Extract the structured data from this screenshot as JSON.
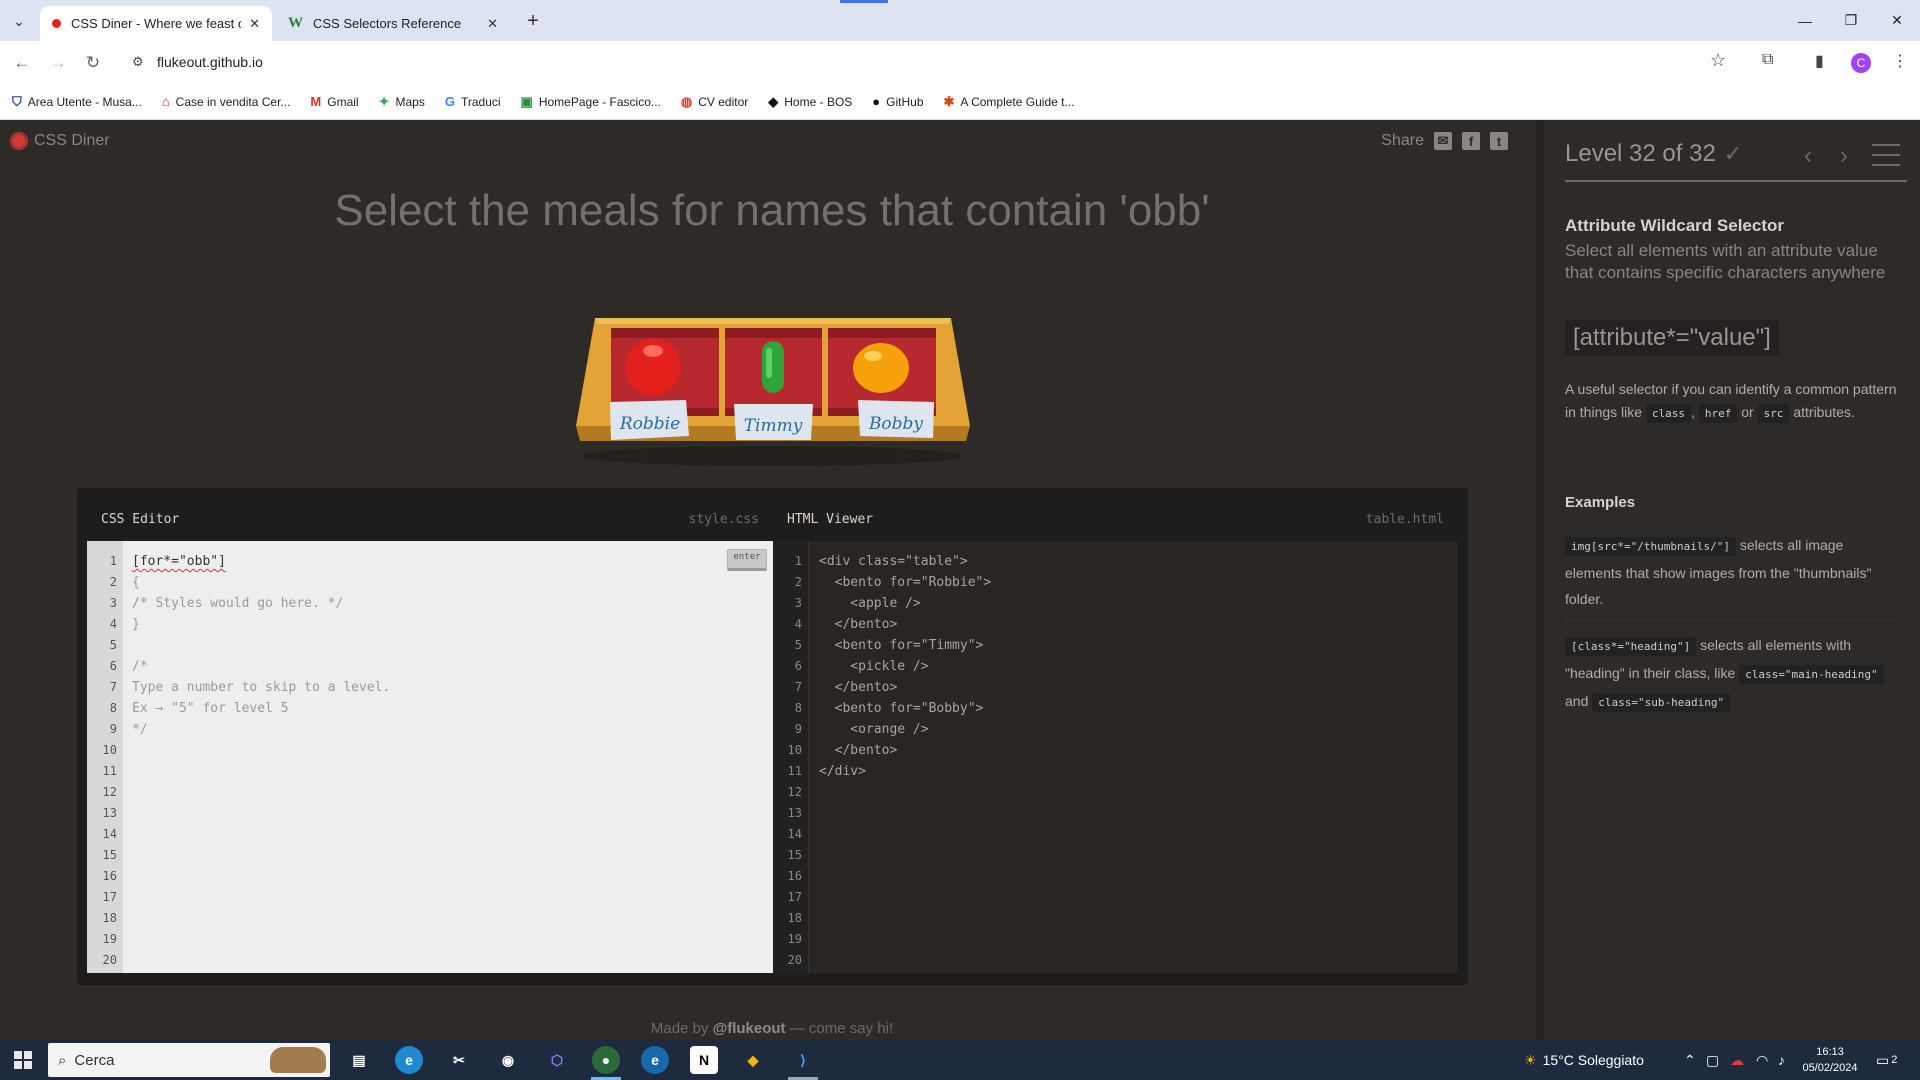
{
  "browser": {
    "tabs": [
      {
        "title": "CSS Diner - Where we feast on",
        "active": true
      },
      {
        "title": "CSS Selectors Reference",
        "active": false
      }
    ],
    "url": "flukeout.github.io",
    "avatar_letter": "C",
    "bookmarks": [
      {
        "label": "Area Utente - Musa...",
        "icon": "shield-icon"
      },
      {
        "label": "Case in vendita Cer...",
        "icon": "house-icon"
      },
      {
        "label": "Gmail",
        "icon": "gmail-icon"
      },
      {
        "label": "Maps",
        "icon": "maps-icon"
      },
      {
        "label": "Traduci",
        "icon": "translate-icon"
      },
      {
        "label": "HomePage - Fascico...",
        "icon": "page-icon"
      },
      {
        "label": "CV editor",
        "icon": "cv-icon"
      },
      {
        "label": "Home - BOS",
        "icon": "bos-icon"
      },
      {
        "label": "GitHub",
        "icon": "github-icon"
      },
      {
        "label": "A Complete Guide t...",
        "icon": "asterisk-icon"
      }
    ]
  },
  "app": {
    "brand": "CSS Diner",
    "share_label": "Share",
    "instruction": "Select the meals for names that contain 'obb'",
    "plates": [
      {
        "name": "Robbie",
        "item": "apple",
        "color": "#e3201b"
      },
      {
        "name": "Timmy",
        "item": "pickle",
        "color": "#2ea43a"
      },
      {
        "name": "Bobby",
        "item": "orange",
        "color": "#f6a10a"
      }
    ],
    "css_editor": {
      "title": "CSS Editor",
      "file": "style.css",
      "enter_label": "enter",
      "input": "[for*=\"obb\"]",
      "lines": [
        "{",
        "/* Styles would go here. */",
        "}",
        "",
        "/*",
        "Type a number to skip to a level.",
        "Ex → \"5\" for level 5",
        "*/"
      ]
    },
    "html_viewer": {
      "title": "HTML Viewer",
      "file": "table.html",
      "lines": [
        "<div class=\"table\">",
        "  <bento for=\"Robbie\">",
        "    <apple />",
        "  </bento>",
        "  <bento for=\"Timmy\">",
        "    <pickle />",
        "  </bento>",
        "  <bento for=\"Bobby\">",
        "    <orange />",
        "  </bento>",
        "</div>"
      ]
    },
    "line_numbers": [
      "1",
      "2",
      "3",
      "4",
      "5",
      "6",
      "7",
      "8",
      "9",
      "10",
      "11",
      "12",
      "13",
      "14",
      "15",
      "16",
      "17",
      "18",
      "19",
      "20"
    ],
    "footer": {
      "prefix": "Made by ",
      "handle": "@flukeout",
      "suffix": " — come say hi!"
    }
  },
  "sidebar": {
    "level_text": "Level 32 of 32",
    "progress": 1.0,
    "selector_name": "Attribute Wildcard Selector",
    "selector_title": "Select all elements with an attribute value that contains specific characters anywhere",
    "syntax": "[attribute*=\"value\"]",
    "hint_prefix": "A useful selector if you can identify a common pattern in things like ",
    "hint_tags": [
      "class",
      "href",
      "src"
    ],
    "hint_or": "or",
    "hint_suffix": "attributes.",
    "examples_title": "Examples",
    "examples": [
      {
        "code": "img[src*=\"/thumbnails/\"]",
        "text": "selects all image elements that show images from the \"thumbnails\" folder."
      },
      {
        "code": "[class*=\"heading\"]",
        "text": "selects all elements with \"heading\" in their class, like",
        "code2": "class=\"main-heading\"",
        "and": "and",
        "code3": "class=\"sub-heading\""
      }
    ]
  },
  "taskbar": {
    "search_placeholder": "Cerca",
    "weather": "15°C Soleggiato",
    "time": "16:13",
    "date": "05/02/2024",
    "notification_count": "2"
  }
}
